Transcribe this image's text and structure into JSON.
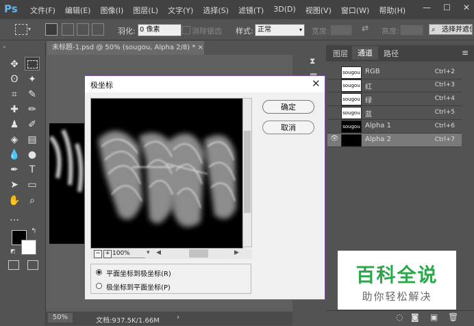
{
  "app": {
    "logo": "Ps"
  },
  "menu": [
    "文件(F)",
    "编辑(E)",
    "图像(I)",
    "图层(L)",
    "文字(Y)",
    "选择(S)",
    "滤镜(T)",
    "3D(D)",
    "视图(V)",
    "窗口(W)",
    "帮助(H)"
  ],
  "window_controls": {
    "minimize": "—",
    "maximize": "☐",
    "close": "✕"
  },
  "options": {
    "feather_label": "羽化:",
    "feather_value": "0 像素",
    "antialias_label": "消除锯齿",
    "style_label": "样式:",
    "style_value": "正常",
    "width_label": "宽度:",
    "height_label": "高度:",
    "select_mask_label": "选择并遮住"
  },
  "document": {
    "tab_title": "未标题-1.psd @ 50% (sougou, Alpha 2/8) *",
    "tab_close": "×",
    "zoom": "50%",
    "doc_size": "文档:937.5K/1.66M",
    "status_arrow": "›"
  },
  "panel": {
    "tabs": [
      "图层",
      "通道",
      "路径"
    ],
    "menu_icon": "≡",
    "channels": [
      {
        "name": "RGB",
        "shortcut": "Ctrl+2",
        "thumb": "sougou",
        "visible": false,
        "dark": false,
        "selected": false
      },
      {
        "name": "红",
        "shortcut": "Ctrl+3",
        "thumb": "sougou",
        "visible": false,
        "dark": false,
        "selected": false
      },
      {
        "name": "绿",
        "shortcut": "Ctrl+4",
        "thumb": "sougou",
        "visible": false,
        "dark": false,
        "selected": false
      },
      {
        "name": "蓝",
        "shortcut": "Ctrl+5",
        "thumb": "sougou",
        "visible": false,
        "dark": false,
        "selected": false
      },
      {
        "name": "Alpha 1",
        "shortcut": "Ctrl+6",
        "thumb": "sougou",
        "visible": false,
        "dark": true,
        "selected": false
      },
      {
        "name": "Alpha 2",
        "shortcut": "Ctrl+7",
        "thumb": "",
        "visible": true,
        "dark": true,
        "selected": true
      }
    ]
  },
  "dialog": {
    "title": "极坐标",
    "close": "✕",
    "ok_label": "确定",
    "cancel_label": "取消",
    "zoom_value": "100%",
    "zoom_minus": "−",
    "zoom_plus": "+",
    "options": [
      {
        "label": "平面坐标到极坐标(R)",
        "checked": true
      },
      {
        "label": "极坐标到平面坐标(P)",
        "checked": false
      }
    ]
  },
  "watermark": {
    "title": "百科全说",
    "subtitle": "助你轻松解决"
  },
  "colors": {
    "dialog_border": "#7b4fa7",
    "watermark_green": "#2aa84a",
    "ps_blue": "#5fb7f0"
  }
}
